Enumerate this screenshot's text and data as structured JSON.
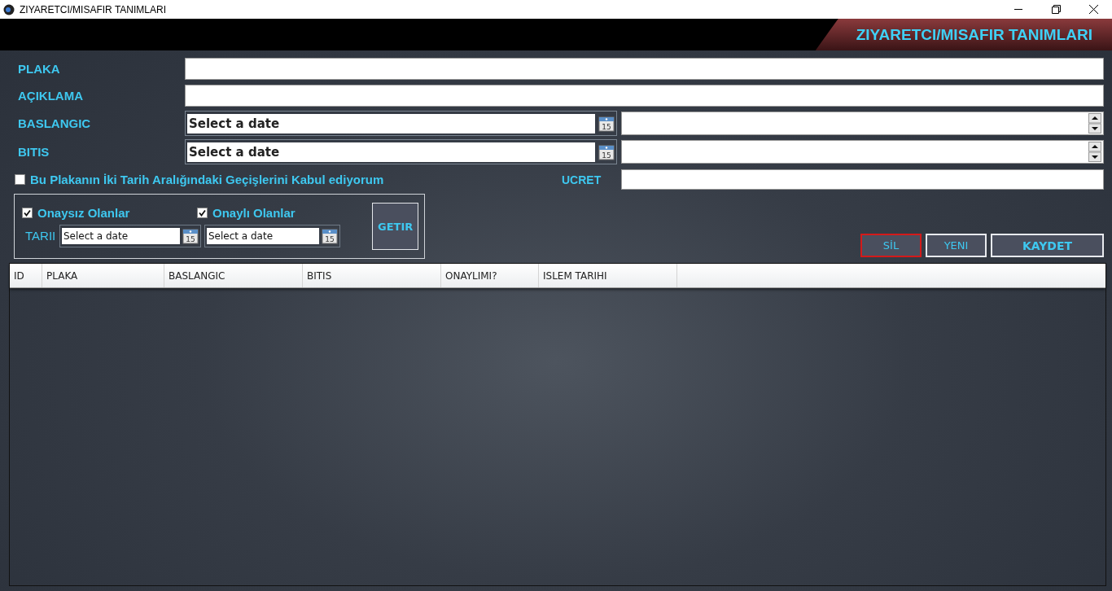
{
  "window": {
    "title": "ZIYARETCI/MISAFIR TANIMLARI"
  },
  "header": {
    "title": "ZIYARETCI/MISAFIR TANIMLARI"
  },
  "fields": [
    {
      "kind": "text",
      "label": "PLAKA"
    },
    {
      "kind": "text",
      "label": "AÇIKLAMA"
    },
    {
      "kind": "datetime",
      "label": "BASLANGIC",
      "placeholder": "Select a date",
      "calendar_day": "15"
    },
    {
      "kind": "datetime",
      "label": "BITIS",
      "placeholder": "Select a date",
      "calendar_day": "15"
    }
  ],
  "accept": {
    "label": "Bu Plakanın İki Tarih Aralığındaki Geçişlerini Kabul ediyorum",
    "checked": false
  },
  "ucret": {
    "label": "UCRET"
  },
  "filter": {
    "checkboxes": [
      {
        "label": "Onaysız Olanlar",
        "checked": true
      },
      {
        "label": "Onaylı Olanlar",
        "checked": true
      }
    ],
    "date_label": "TARII",
    "dates": [
      {
        "placeholder": "Select a date",
        "calendar_day": "15"
      },
      {
        "placeholder": "Select a date",
        "calendar_day": "15"
      }
    ],
    "button": "GETIR"
  },
  "buttons": [
    {
      "label": "SİL",
      "kind": "normal",
      "focused": true
    },
    {
      "label": "YENI",
      "kind": "normal",
      "focused": false
    },
    {
      "label": "KAYDET",
      "kind": "primary",
      "focused": false
    }
  ],
  "table": {
    "columns": [
      "ID",
      "PLAKA",
      "BASLANGIC",
      "BITIS",
      "ONAYLIMI?",
      "ISLEM TARIHI"
    ]
  }
}
